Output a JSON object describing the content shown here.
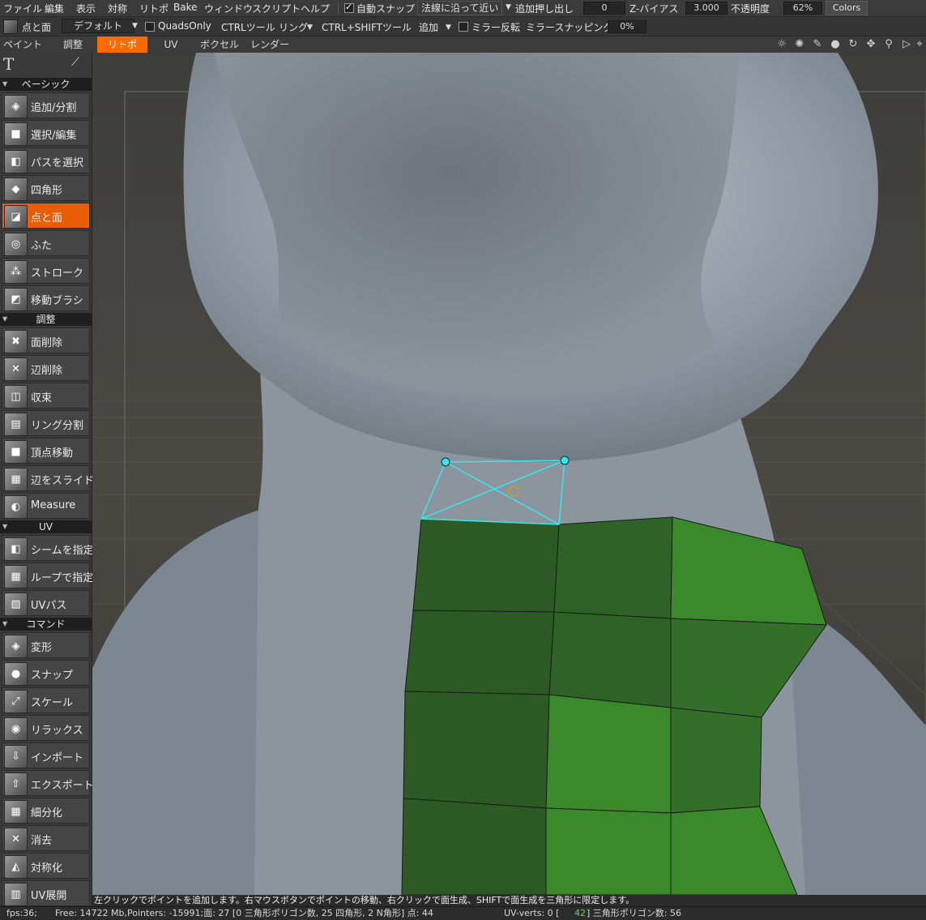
{
  "menu": [
    "ファイル",
    "編集",
    "表示",
    "対称",
    "リトポ",
    "Bake",
    "ウィンドウ",
    "スクリプト",
    "ヘルプ"
  ],
  "menu_options": {
    "auto_snap_label": "自動スナップ",
    "auto_snap_checked": true,
    "snap_mode": "法線に沿って近い",
    "extrude_label": "追加押し出し",
    "extrude_value": "0",
    "zbias_label": "Z-バイアス",
    "zbias_value": "3.000",
    "opacity_label": "不透明度",
    "opacity_value": "62%",
    "colors_button": "Colors"
  },
  "toolbar": {
    "tool_name": "点と面",
    "preset": "デフォルト",
    "quads_only_label": "QuadsOnly",
    "ctrl_tool_label": "CTRLツール",
    "ctrl_tool_value": "リング",
    "ctrl_shift_label": "CTRL+SHIFTツール",
    "ctrl_shift_value": "追加",
    "mirror_label": "ミラー反転",
    "mirror_snap_label": "ミラースナッピング",
    "mirror_snap_value": "0%"
  },
  "rooms": [
    "ペイント",
    "調整",
    "リトポ",
    "UV",
    "ボクセル",
    "レンダー"
  ],
  "active_room": "リトポ",
  "sidebar": {
    "sections": {
      "basic": "ベーシック",
      "adjust": "調整",
      "uv": "UV",
      "command": "コマンド"
    },
    "basic_tools": [
      "追加/分割",
      "選択/編集",
      "パスを選択",
      "四角形",
      "点と面",
      "ふた",
      "ストローク",
      "移動ブラシ"
    ],
    "adjust_tools": [
      "面削除",
      "辺削除",
      "収束",
      "リング分割",
      "頂点移動",
      "辺をスライド",
      "Measure"
    ],
    "uv_tools": [
      "シームを指定",
      "ループで指定",
      "UVパス"
    ],
    "command_tools": [
      "変形",
      "スナップ",
      "スケール",
      "リラックス",
      "インポート",
      "エクスポート",
      "細分化",
      "消去",
      "対称化",
      "UV展開"
    ],
    "active_tool": "点と面"
  },
  "hint": "左クリックでポイントを追加します。右マウスボタンでポイントの移動、右クリックで面生成、SHIFTで面生成を三角形に限定します。",
  "status": {
    "fps": "fps:36;",
    "free": "Free: 14722 Mb,Pointers: -15991;面: 27 [0 三角形ポリゴン数, 25 四角形, 2 N角形] 点: 44",
    "uv_verts": "UV-verts: 0 [",
    "uv_verts_highlight": "42",
    "triangles": "] 三角形ポリゴン数: 56"
  }
}
